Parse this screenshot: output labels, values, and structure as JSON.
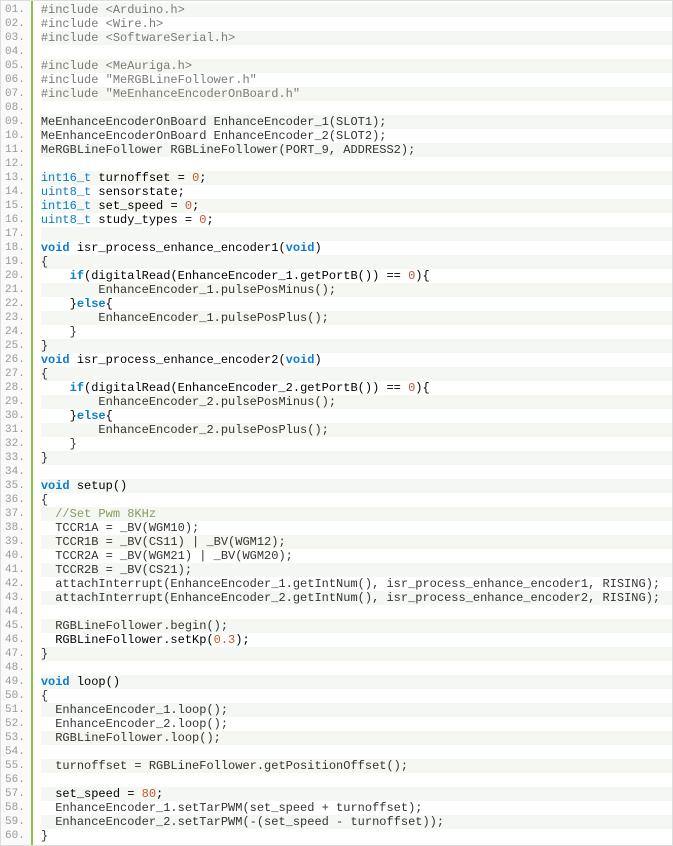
{
  "lines": [
    {
      "n": "01.",
      "cls": "pp",
      "html": "#include &lt;Arduino.h&gt;"
    },
    {
      "n": "02.",
      "cls": "pp",
      "html": "#include &lt;Wire.h&gt;"
    },
    {
      "n": "03.",
      "cls": "pp",
      "html": "#include &lt;SoftwareSerial.h&gt;"
    },
    {
      "n": "04.",
      "cls": "",
      "html": ""
    },
    {
      "n": "05.",
      "cls": "pp",
      "html": "#include &lt;MeAuriga.h&gt;"
    },
    {
      "n": "06.",
      "cls": "pp",
      "html": "#include \"MeRGBLineFollower.h\""
    },
    {
      "n": "07.",
      "cls": "pp",
      "html": "#include \"MeEnhanceEncoderOnBoard.h\""
    },
    {
      "n": "08.",
      "cls": "",
      "html": ""
    },
    {
      "n": "09.",
      "cls": "plain",
      "html": "MeEnhanceEncoderOnBoard EnhanceEncoder_1(SLOT1);"
    },
    {
      "n": "10.",
      "cls": "plain",
      "html": "MeEnhanceEncoderOnBoard EnhanceEncoder_2(SLOT2);"
    },
    {
      "n": "11.",
      "cls": "plain",
      "html": "MeRGBLineFollower RGBLineFollower(PORT_9, ADDRESS2);"
    },
    {
      "n": "12.",
      "cls": "",
      "html": ""
    },
    {
      "n": "13.",
      "cls": "",
      "html": "<span class=\"type\">int16_t</span> turnoffset = <span class=\"num\">0</span>;"
    },
    {
      "n": "14.",
      "cls": "",
      "html": "<span class=\"type\">uint8_t</span> sensorstate;"
    },
    {
      "n": "15.",
      "cls": "",
      "html": "<span class=\"type\">int16_t</span> set_speed = <span class=\"num\">0</span>;"
    },
    {
      "n": "16.",
      "cls": "",
      "html": "<span class=\"type\">uint8_t</span> study_types = <span class=\"num\">0</span>;"
    },
    {
      "n": "17.",
      "cls": "",
      "html": ""
    },
    {
      "n": "18.",
      "cls": "",
      "html": "<span class=\"kw\">void</span> isr_process_enhance_encoder1(<span class=\"kw\">void</span>)"
    },
    {
      "n": "19.",
      "cls": "plain",
      "html": "{"
    },
    {
      "n": "20.",
      "cls": "",
      "html": "    <span class=\"kw\">if</span>(digitalRead(EnhanceEncoder_1.getPortB()) == <span class=\"num\">0</span>){"
    },
    {
      "n": "21.",
      "cls": "plain",
      "html": "        EnhanceEncoder_1.pulsePosMinus();"
    },
    {
      "n": "22.",
      "cls": "",
      "html": "    }<span class=\"kw\">else</span>{"
    },
    {
      "n": "23.",
      "cls": "plain",
      "html": "        EnhanceEncoder_1.pulsePosPlus();"
    },
    {
      "n": "24.",
      "cls": "plain",
      "html": "    }"
    },
    {
      "n": "25.",
      "cls": "plain",
      "html": "}"
    },
    {
      "n": "26.",
      "cls": "",
      "html": "<span class=\"kw\">void</span> isr_process_enhance_encoder2(<span class=\"kw\">void</span>)"
    },
    {
      "n": "27.",
      "cls": "plain",
      "html": "{"
    },
    {
      "n": "28.",
      "cls": "",
      "html": "    <span class=\"kw\">if</span>(digitalRead(EnhanceEncoder_2.getPortB()) == <span class=\"num\">0</span>){"
    },
    {
      "n": "29.",
      "cls": "plain",
      "html": "        EnhanceEncoder_2.pulsePosMinus();"
    },
    {
      "n": "30.",
      "cls": "",
      "html": "    }<span class=\"kw\">else</span>{"
    },
    {
      "n": "31.",
      "cls": "plain",
      "html": "        EnhanceEncoder_2.pulsePosPlus();"
    },
    {
      "n": "32.",
      "cls": "plain",
      "html": "    }"
    },
    {
      "n": "33.",
      "cls": "plain",
      "html": "}"
    },
    {
      "n": "34.",
      "cls": "",
      "html": ""
    },
    {
      "n": "35.",
      "cls": "",
      "html": "<span class=\"kw\">void</span> setup()"
    },
    {
      "n": "36.",
      "cls": "plain",
      "html": "{"
    },
    {
      "n": "37.",
      "cls": "",
      "html": "  <span class=\"cmt\">//Set Pwm 8KHz</span>"
    },
    {
      "n": "38.",
      "cls": "plain",
      "html": "  TCCR1A = _BV(WGM10);"
    },
    {
      "n": "39.",
      "cls": "plain",
      "html": "  TCCR1B = _BV(CS11) | _BV(WGM12);"
    },
    {
      "n": "40.",
      "cls": "plain",
      "html": "  TCCR2A = _BV(WGM21) | _BV(WGM20);"
    },
    {
      "n": "41.",
      "cls": "plain",
      "html": "  TCCR2B = _BV(CS21);"
    },
    {
      "n": "42.",
      "cls": "plain",
      "html": "  attachInterrupt(EnhanceEncoder_1.getIntNum(), isr_process_enhance_encoder1, RISING);"
    },
    {
      "n": "43.",
      "cls": "plain",
      "html": "  attachInterrupt(EnhanceEncoder_2.getIntNum(), isr_process_enhance_encoder2, RISING);"
    },
    {
      "n": "44.",
      "cls": "",
      "html": ""
    },
    {
      "n": "45.",
      "cls": "plain",
      "html": "  RGBLineFollower.begin();"
    },
    {
      "n": "46.",
      "cls": "",
      "html": "  RGBLineFollower.setKp(<span class=\"num\">0.3</span>);"
    },
    {
      "n": "47.",
      "cls": "plain",
      "html": "}"
    },
    {
      "n": "48.",
      "cls": "",
      "html": ""
    },
    {
      "n": "49.",
      "cls": "",
      "html": "<span class=\"kw\">void</span> loop()"
    },
    {
      "n": "50.",
      "cls": "plain",
      "html": "{"
    },
    {
      "n": "51.",
      "cls": "plain",
      "html": "  EnhanceEncoder_1.loop();"
    },
    {
      "n": "52.",
      "cls": "plain",
      "html": "  EnhanceEncoder_2.loop();"
    },
    {
      "n": "53.",
      "cls": "plain",
      "html": "  RGBLineFollower.loop();"
    },
    {
      "n": "54.",
      "cls": "",
      "html": ""
    },
    {
      "n": "55.",
      "cls": "plain",
      "html": "  turnoffset = RGBLineFollower.getPositionOffset();"
    },
    {
      "n": "56.",
      "cls": "",
      "html": ""
    },
    {
      "n": "57.",
      "cls": "",
      "html": "  set_speed = <span class=\"num\">80</span>;"
    },
    {
      "n": "58.",
      "cls": "plain",
      "html": "  EnhanceEncoder_1.setTarPWM(set_speed + turnoffset);"
    },
    {
      "n": "59.",
      "cls": "plain",
      "html": "  EnhanceEncoder_2.setTarPWM(-(set_speed - turnoffset));"
    },
    {
      "n": "60.",
      "cls": "plain",
      "html": "}"
    }
  ]
}
